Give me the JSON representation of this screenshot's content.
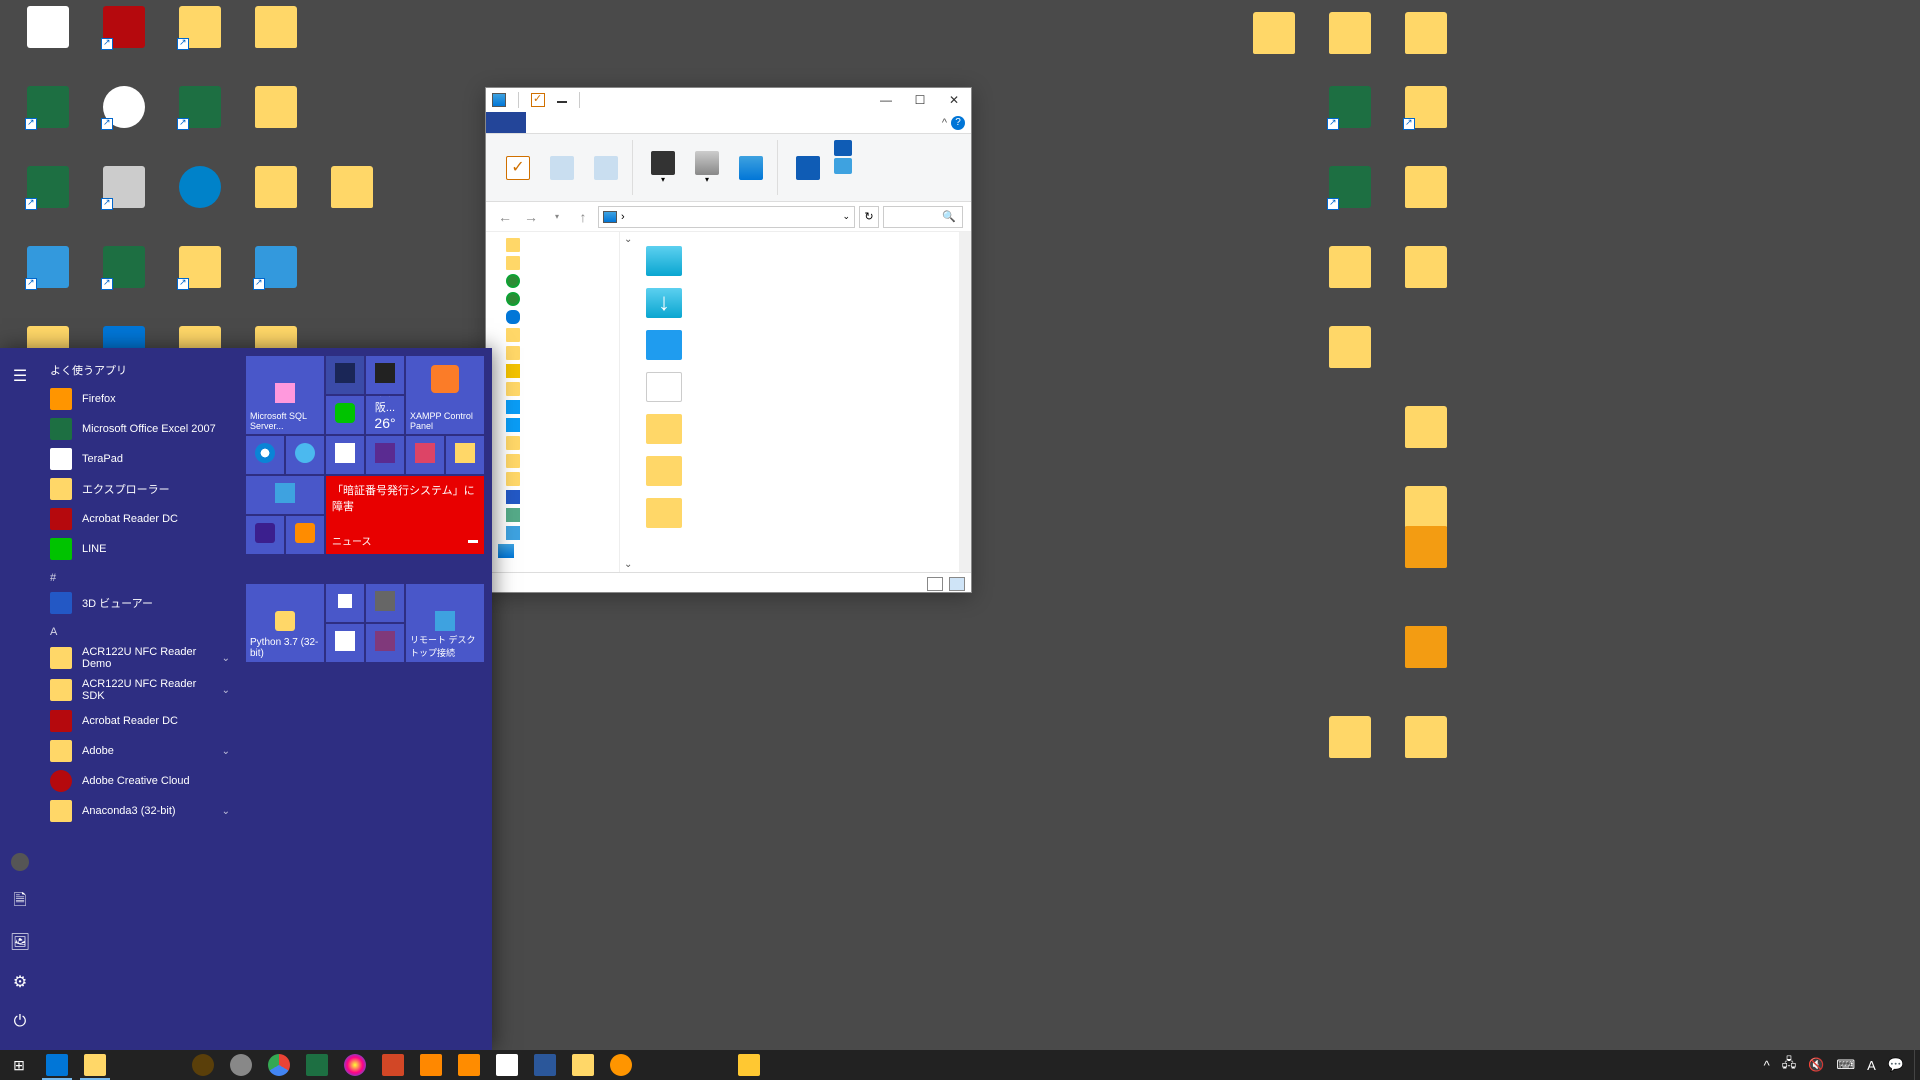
{
  "startmenu": {
    "frequent_header": "よく使うアプリ",
    "frequent": [
      {
        "label": "Firefox",
        "icon": "ff"
      },
      {
        "label": "Microsoft Office Excel 2007",
        "icon": "xl"
      },
      {
        "label": "TeraPad",
        "icon": "tp"
      },
      {
        "label": "エクスプローラー",
        "icon": "exp"
      },
      {
        "label": "Acrobat Reader DC",
        "icon": "ar"
      },
      {
        "label": "LINE",
        "icon": "ln"
      }
    ],
    "letter_hash": "#",
    "hash_items": [
      {
        "label": "3D ビューアー",
        "icon": "v3d"
      }
    ],
    "letter_a": "A",
    "a_items": [
      {
        "label": "ACR122U NFC Reader Demo",
        "icon": "fold",
        "expand": true
      },
      {
        "label": "ACR122U NFC Reader SDK",
        "icon": "fold",
        "expand": true
      },
      {
        "label": "Acrobat Reader DC",
        "icon": "ar"
      },
      {
        "label": "Adobe",
        "icon": "fold",
        "expand": true
      },
      {
        "label": "Adobe Creative Cloud",
        "icon": "cc"
      },
      {
        "label": "Anaconda3 (32-bit)",
        "icon": "fold",
        "expand": true
      }
    ],
    "tiles": {
      "sql": "Microsoft SQL Server...",
      "weather_loc": "大阪...",
      "weather_temp": "26°",
      "xampp": "XAMPP Control Panel",
      "news_headline": "「暗証番号発行システム」に障害",
      "news_label": "ニュース",
      "python": "Python 3.7 (32-bit)",
      "rdp": "リモート デスクトップ接続"
    }
  },
  "explorer": {
    "min": "—",
    "max": "☐",
    "close": "✕",
    "help": "?",
    "chevup": "^",
    "back": "←",
    "fwd": "→",
    "up": "↑",
    "crumb_sep": "›",
    "refresh": "↻"
  },
  "tray": {
    "chevron": "^",
    "ime": "A"
  }
}
